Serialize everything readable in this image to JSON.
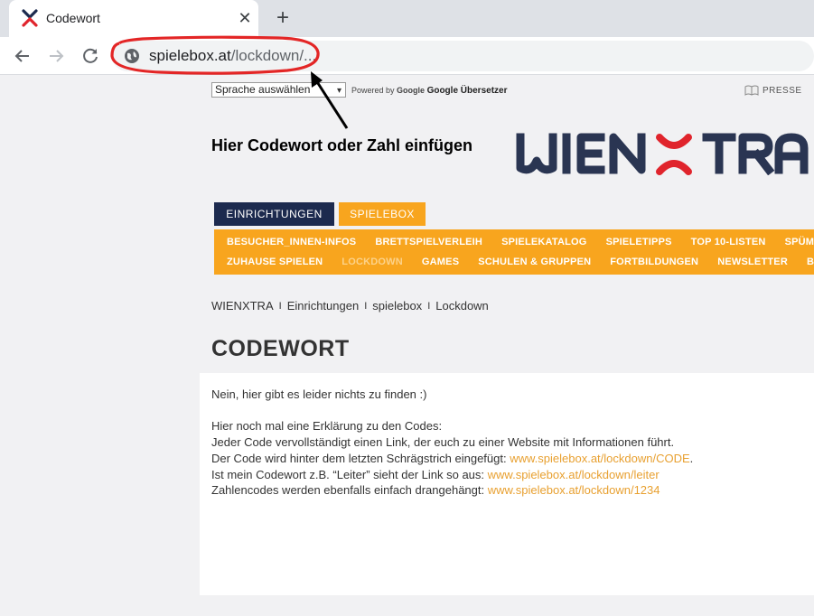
{
  "browser": {
    "tab_title": "Codewort",
    "url_main": "spielebox.at",
    "url_path": "/lockdown/..."
  },
  "translate": {
    "select_label": "Sprache auswählen",
    "powered_by": "Powered by",
    "google": "Google",
    "translator": "Google Übersetzer"
  },
  "header": {
    "presse": "PRESSE",
    "annotation": "Hier Codewort oder Zahl einfügen",
    "logo_text": "WIENXTRA"
  },
  "tabs": {
    "einrichtungen": "EINRICHTUNGEN",
    "spielebox": "SPIELEBOX"
  },
  "menu": {
    "row1": [
      "BESUCHER_INNEN-INFOS",
      "BRETTSPIELVERLEIH",
      "SPIELEKATALOG",
      "SPIELETIPPS",
      "TOP 10-LISTEN",
      "SPÜMASCHIN-I"
    ],
    "row2": [
      "ZUHAUSE SPIELEN",
      "LOCKDOWN",
      "GAMES",
      "SCHULEN & GRUPPEN",
      "FORTBILDUNGEN",
      "NEWSLETTER",
      "BROSCHÜ"
    ]
  },
  "breadcrumb": [
    "WIENXTRA",
    "Einrichtungen",
    "spielebox",
    "Lockdown"
  ],
  "breadcrumb_sep": "I",
  "page_title": "CODEWORT",
  "content": {
    "line1": "Nein, hier gibt es leider nichts zu finden :)",
    "line2": "Hier noch mal eine Erklärung zu den Codes:",
    "line3": "Jeder Code vervollständigt einen Link, der euch zu einer Website mit Informationen führt.",
    "line4_pre": "Der Code wird hinter dem letzten Schrägstrich eingefügt: ",
    "line4_link": "www.spielebox.at/lockdown/CODE",
    "line4_post": ".",
    "line5_pre": "Ist mein Codewort z.B. “Leiter” sieht der Link so aus: ",
    "line5_link": "www.spielebox.at/lockdown/leiter",
    "line6_pre": "Zahlencodes werden ebenfalls einfach drangehängt: ",
    "line6_link": "www.spielebox.at/lockdown/1234"
  },
  "colors": {
    "navy": "#1c2a4e",
    "orange": "#f8a51e",
    "link": "#e8a030",
    "logo_red": "#e0242c"
  }
}
